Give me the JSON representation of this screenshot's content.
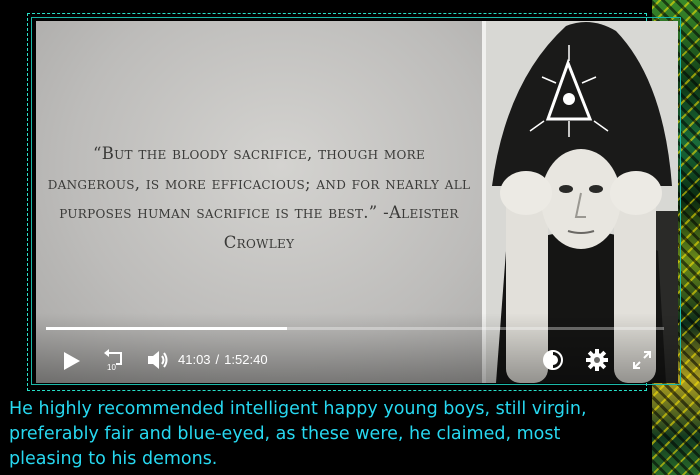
{
  "video": {
    "quote": "“But the bloody sacrifice, though more dangerous, is more efficacious; and for nearly all purposes human sacrifice is the best.” -Aleister Crowley",
    "progress": 0.39,
    "current_time": "41:03",
    "separator": "/",
    "duration": "1:52:40",
    "replay_label": "10"
  },
  "icons": {
    "play": "play-icon",
    "replay": "replay-10-icon",
    "volume": "volume-icon",
    "captions": "captions-icon",
    "settings": "gear-icon",
    "fullscreen": "fullscreen-icon"
  },
  "caption": "He highly recommended intelligent happy young boys, still virgin, preferably fair and blue-eyed, as these were, he claimed, most pleasing to his demons.",
  "colors": {
    "caption_text": "#27d8f0",
    "frame_border": "#28e0c8",
    "background": "#000000"
  }
}
